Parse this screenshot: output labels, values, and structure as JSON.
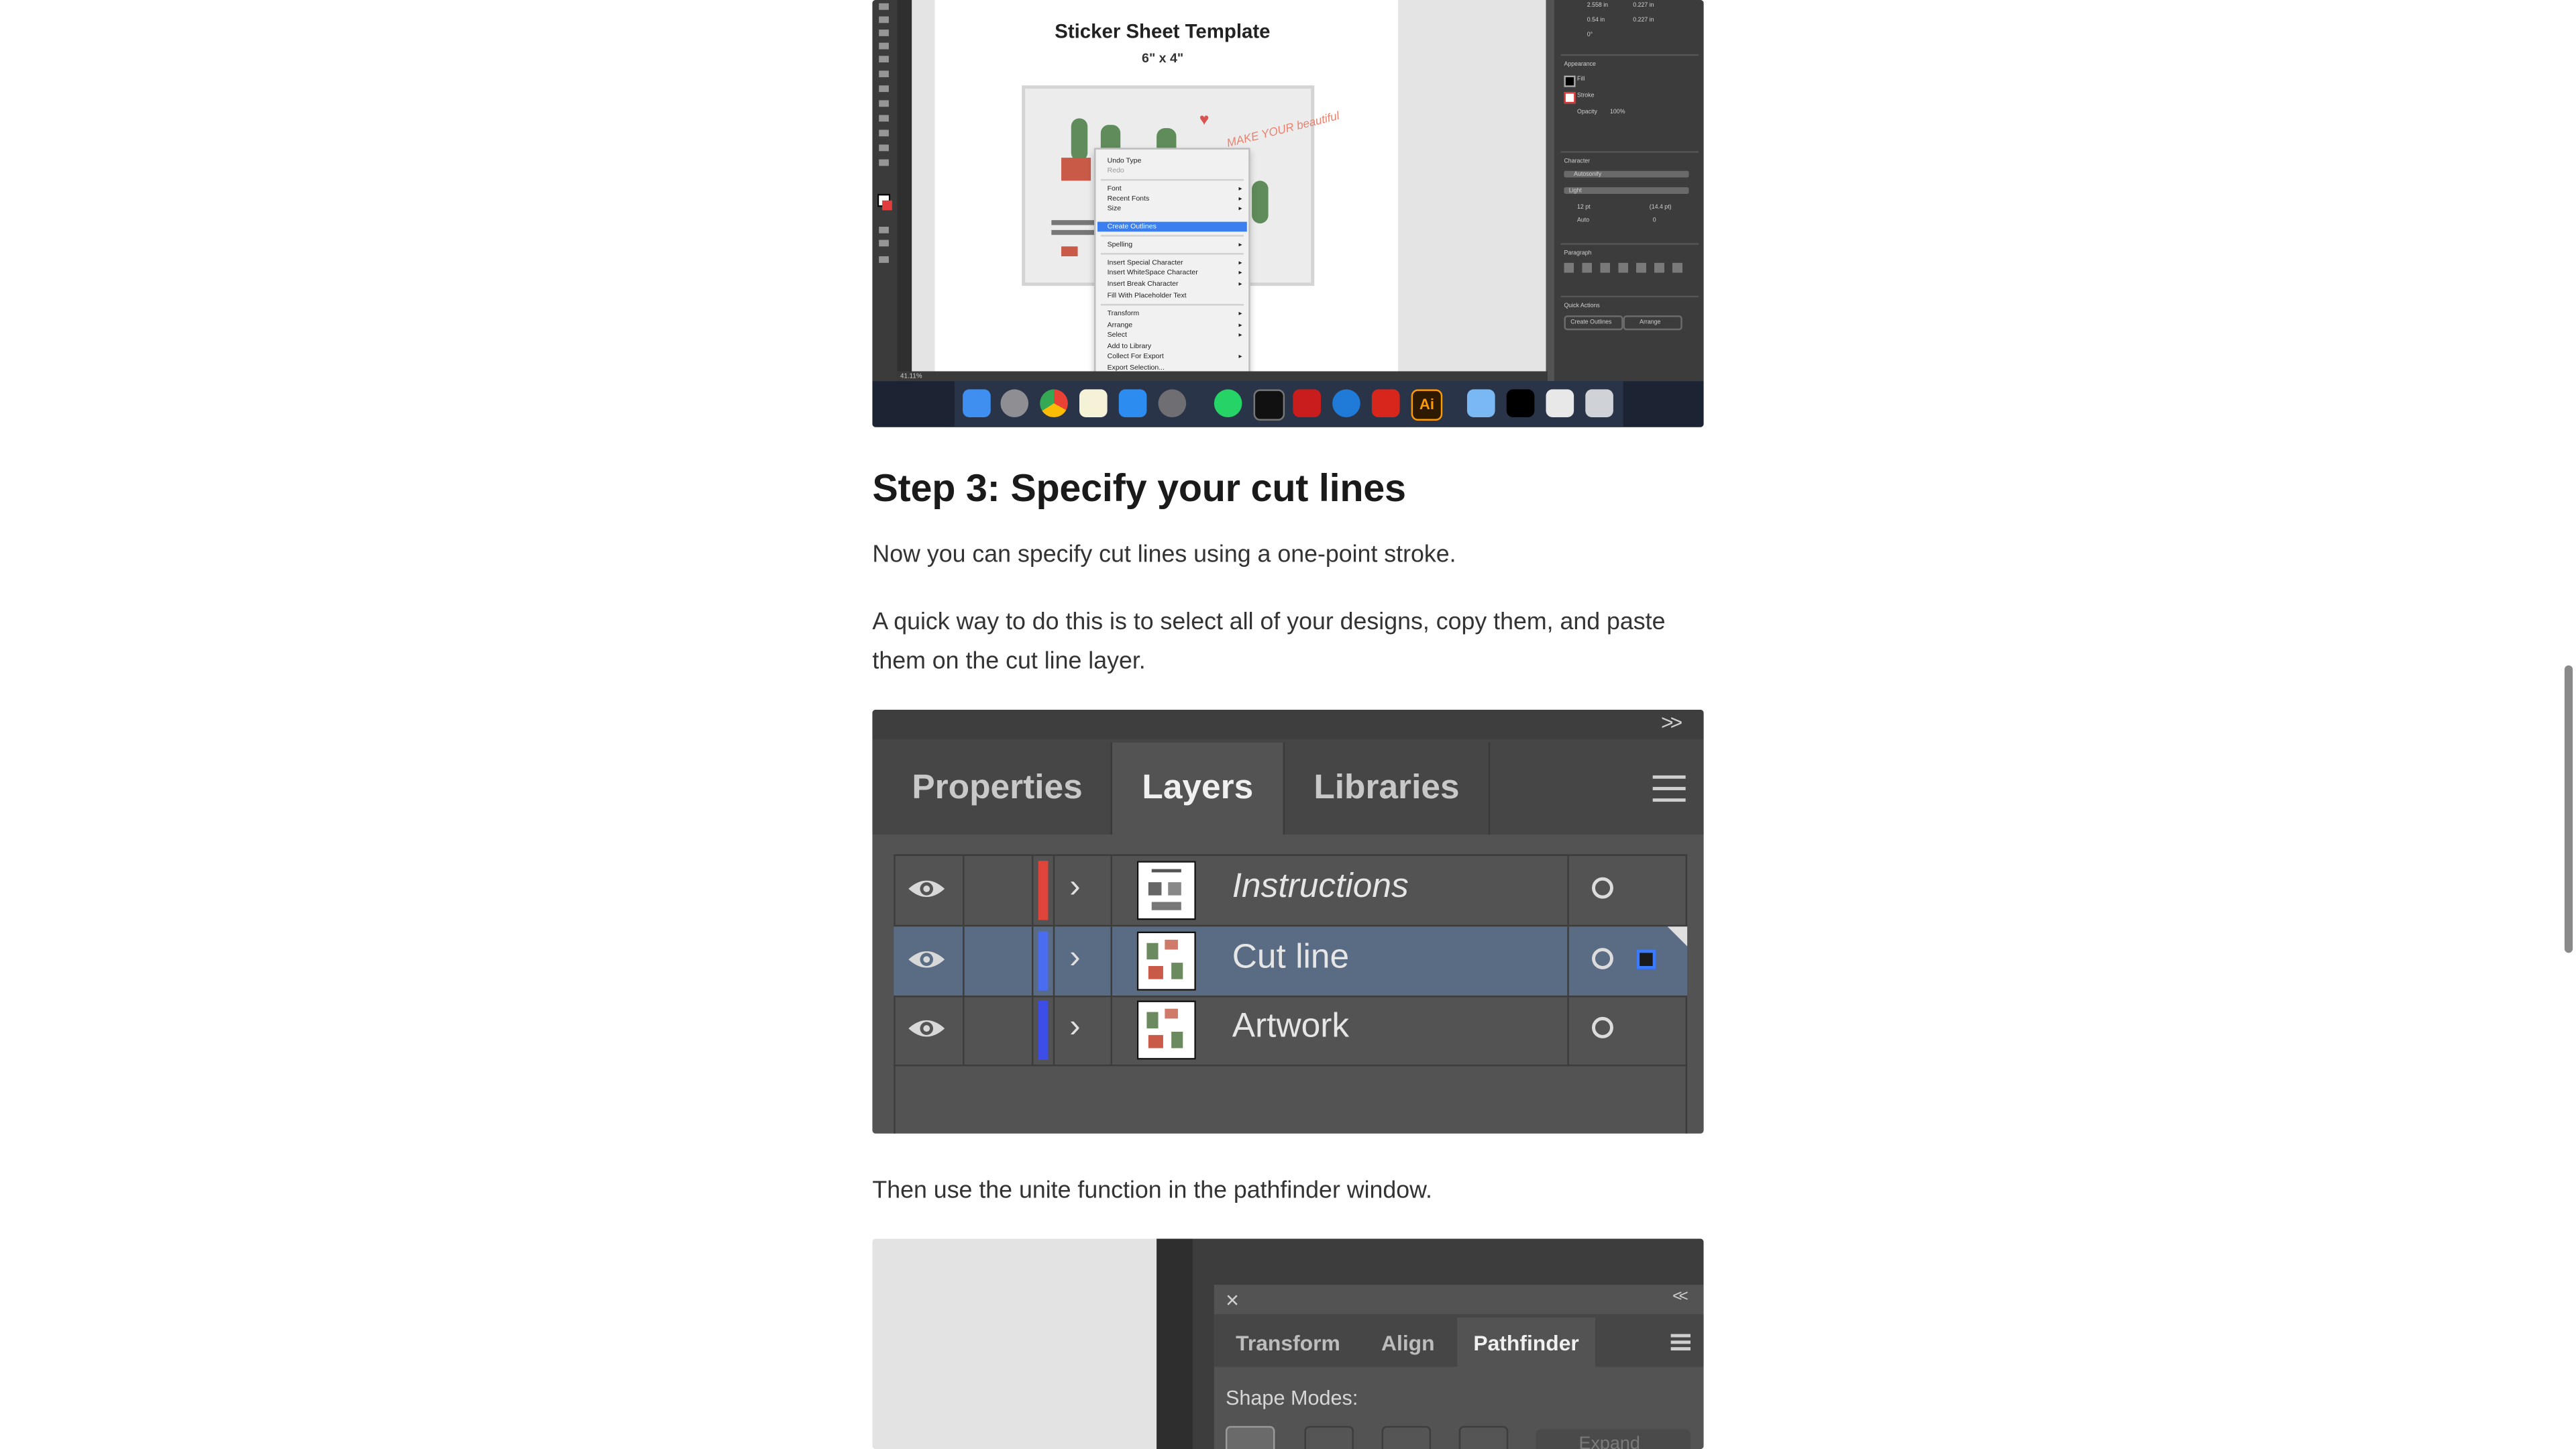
{
  "screenshot1": {
    "template_title": "Sticker Sheet Template",
    "template_size": "6\" x 4\"",
    "sticker_text": "MAKE YOUR beautiful",
    "context_menu": {
      "items": [
        "Undo Type",
        "Redo",
        "Font",
        "Recent Fonts",
        "Size",
        "Create Outlines",
        "Spelling",
        "Insert Special Character",
        "Insert WhiteSpace Character",
        "Insert Break Character",
        "Fill With Placeholder Text",
        "Transform",
        "Arrange",
        "Select",
        "Add to Library",
        "Collect For Export",
        "Export Selection..."
      ],
      "highlighted": "Create Outlines"
    },
    "right_panel": {
      "appearance": "Appearance",
      "fill": "Fill",
      "stroke": "Stroke",
      "opacity": "Opacity",
      "opacity_value": "100%",
      "character": "Character",
      "font_name": "Autosonify",
      "font_style": "Light",
      "font_size": "12 pt",
      "leading": "(14.4 pt)",
      "tracking": "Auto",
      "kerning": "0",
      "paragraph": "Paragraph",
      "quick_actions": "Quick Actions",
      "create_outlines_btn": "Create Outlines",
      "arrange_btn": "Arrange",
      "x_value": "2.558 in",
      "y_value": "0.54 in",
      "w_value": "0.227 in",
      "h_value": "0.227 in",
      "angle": "0°"
    },
    "zoom": "41.11%",
    "brand_color": "#ff9a00"
  },
  "heading": "Step 3: Specify your cut lines",
  "paragraph1": "Now you can specify cut lines using a one-point stroke.",
  "paragraph2_line1": "A quick way to do this is to select all of your designs, copy them, and paste",
  "paragraph2_line2": "them on the cut line layer.",
  "layers_panel": {
    "collapse_glyph": ">>",
    "tabs": [
      "Properties",
      "Layers",
      "Libraries"
    ],
    "active_tab": "Layers",
    "layers": [
      {
        "name": "Instructions",
        "color": "#e0453c",
        "selected": false,
        "italic": true
      },
      {
        "name": "Cut line",
        "color": "#4a6cf0",
        "selected": true,
        "italic": false
      },
      {
        "name": "Artwork",
        "color": "#3d4de8",
        "selected": false,
        "italic": false
      }
    ]
  },
  "paragraph3": "Then use the unite function in the pathfinder window.",
  "pathfinder_panel": {
    "close_glyph": "×",
    "collapse_glyph": "<<",
    "tabs": [
      "Transform",
      "Align",
      "Pathfinder"
    ],
    "active_tab": "Pathfinder",
    "shape_modes_label": "Shape Modes:",
    "expand_label": "Expand"
  }
}
